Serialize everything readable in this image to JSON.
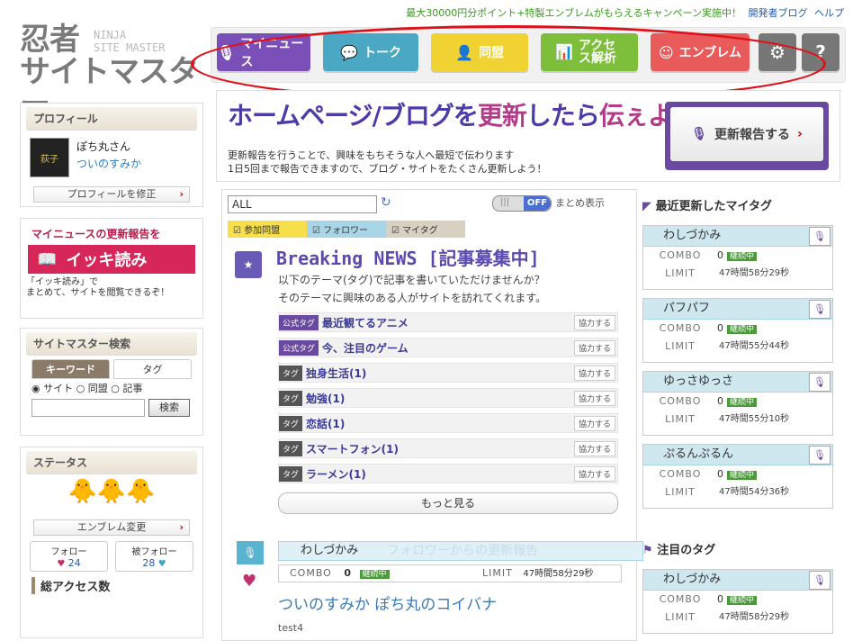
{
  "top": {
    "promo": "最大30000円分ポイント+特製エンブレムがもらえるキャンペーン実施中！",
    "links": [
      "開発者ブログ",
      "ヘルプ"
    ]
  },
  "logo": {
    "line1": "忍者",
    "line2": "サイトマスター",
    "en1": "NINJA",
    "en2": "SITE MASTER"
  },
  "nav": {
    "news": "マイニュース",
    "talk": "トーク",
    "alliance": "同盟",
    "access": "アクセス解析",
    "emblem": "エンブレム",
    "settings_icon": "gear-icon",
    "help_icon": "help-icon"
  },
  "profile": {
    "header": "プロフィール",
    "name": "ぽち丸さん",
    "link": "ついのすみか",
    "avatar_text": "荻子",
    "edit": "プロフィールを修正"
  },
  "ikki": {
    "title": "マイニュースの更新報告を",
    "button": "イッキ読み",
    "note1": "「イッキ読み」で",
    "note2": "まとめて、サイトを閲覧できるぞ！"
  },
  "search": {
    "header": "サイトマスター検索",
    "tab_keyword": "キーワード",
    "tab_tag": "タグ",
    "radio_site": "サイト",
    "radio_alliance": "同盟",
    "radio_article": "記事",
    "button": "検索"
  },
  "status": {
    "header": "ステータス",
    "emblem_btn": "エンブレム変更",
    "follow_label": "フォロー",
    "follow_count": "24",
    "follower_label": "被フォロー",
    "follower_count": "28",
    "access_header": "総アクセス数"
  },
  "banner": {
    "title_a": "ホームページ/ブログを",
    "title_b": "更新",
    "title_c": "したら",
    "title_d": "伝ぇよう",
    "sub1": "更新報告を行うことで、興味をもちそうな人へ最短で伝わります",
    "sub2": "1日5回まで報告できますので、ブログ・サイトをたくさん更新しよう！",
    "report_btn": "更新報告する"
  },
  "feed": {
    "filter_value": "ALL",
    "toggle_on": "|||",
    "toggle_off": "OFF",
    "collapse_label": "まとめ表示",
    "chips": [
      "参加同盟",
      "フォロワー",
      "マイタグ"
    ],
    "breaking_title": "Breaking NEWS [記事募集中]",
    "breaking_desc1": "以下のテーマ(タグ)で記事を書いていただけませんか？",
    "breaking_desc2": "そのテーマに興味のある人がサイトを訪れてくれます。",
    "tags": [
      {
        "badge": "公式タグ",
        "text": "最近観てるアニメ",
        "coop": "協力する"
      },
      {
        "badge": "公式タグ",
        "text": "今、注目のゲーム",
        "coop": "協力する"
      },
      {
        "badge": "タグ",
        "text": "独身生活(1)",
        "coop": "協力する"
      },
      {
        "badge": "タグ",
        "text": "勉強(1)",
        "coop": "協力する"
      },
      {
        "badge": "タグ",
        "text": "恋話(1)",
        "coop": "協力する"
      },
      {
        "badge": "タグ",
        "text": "スマートフォン(1)",
        "coop": "協力する"
      },
      {
        "badge": "タグ",
        "text": "ラーメン(1)",
        "coop": "協力する"
      }
    ],
    "more": "もっと見る",
    "item": {
      "tag": "わしづかみ",
      "ghost": "フォロワーからの更新報告",
      "combo_label": "COMBO",
      "combo_value": "0",
      "continuing": "継続中",
      "limit_label": "LIMIT",
      "limit_value": "47時間58分29秒",
      "title": "ついのすみか ぽち丸のコイバナ",
      "snippet": "test4"
    }
  },
  "right": {
    "recent_header": "最近更新したマイタグ",
    "focus_header": "注目のタグ",
    "cards": [
      {
        "name": "わしづかみ",
        "combo": "0",
        "cont": "継続中",
        "limit": "47時間58分29秒"
      },
      {
        "name": "パフパフ",
        "combo": "0",
        "cont": "継続中",
        "limit": "47時間55分44秒"
      },
      {
        "name": "ゆっさゆっさ",
        "combo": "0",
        "cont": "継続中",
        "limit": "47時間55分10秒"
      },
      {
        "name": "ぷるんぷるん",
        "combo": "0",
        "cont": "継続中",
        "limit": "47時間54分36秒"
      }
    ],
    "focus_card": {
      "name": "わしづかみ",
      "combo": "0",
      "cont": "継続中",
      "limit": "47時間58分29秒"
    },
    "combo_label": "COMBO",
    "limit_label": "LIMIT"
  }
}
